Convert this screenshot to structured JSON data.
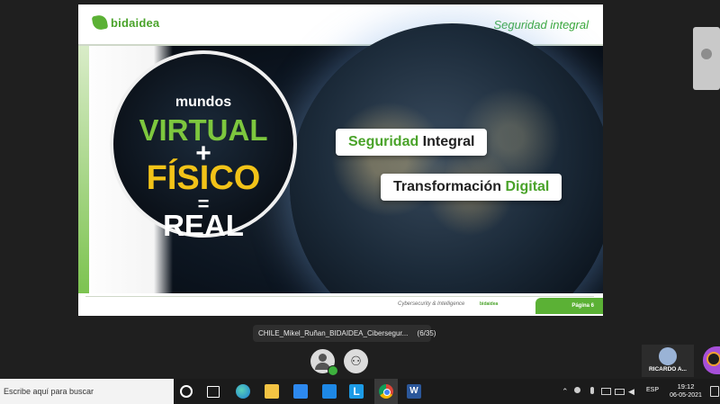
{
  "slide": {
    "brand": "bidaidea",
    "title": "Seguridad integral",
    "circle_lines": {
      "mundos": "mundos",
      "virtual": "VIRTUAL",
      "plus": "+",
      "fisico": "FÍSICO",
      "equals": "=",
      "real": "REAL"
    },
    "pill1": {
      "part1": "Seguridad",
      "part2": " Integral"
    },
    "pill2": {
      "part1": "Transformación",
      "part2": " Digital"
    },
    "footer_caption": "Cybersecurity & Intelligence",
    "footer_logo": "bidaidea",
    "page_label": "Página 6"
  },
  "share_bar": {
    "label": "CHILE_Mikel_Ruñan_BIDAIDEA_Cibersegur...",
    "counter": "(6/35)"
  },
  "participant": {
    "name": "RICARDO A..."
  },
  "taskbar": {
    "search_placeholder": "Escribe aquí para buscar",
    "l_app": "L",
    "word_app": "W",
    "language": "ESP",
    "time": "19:12",
    "date": "06-05-2021"
  },
  "colors": {
    "brand_green": "#5bb135",
    "fisico_yellow": "#f2c318",
    "virtual_green": "#7dc73e"
  }
}
